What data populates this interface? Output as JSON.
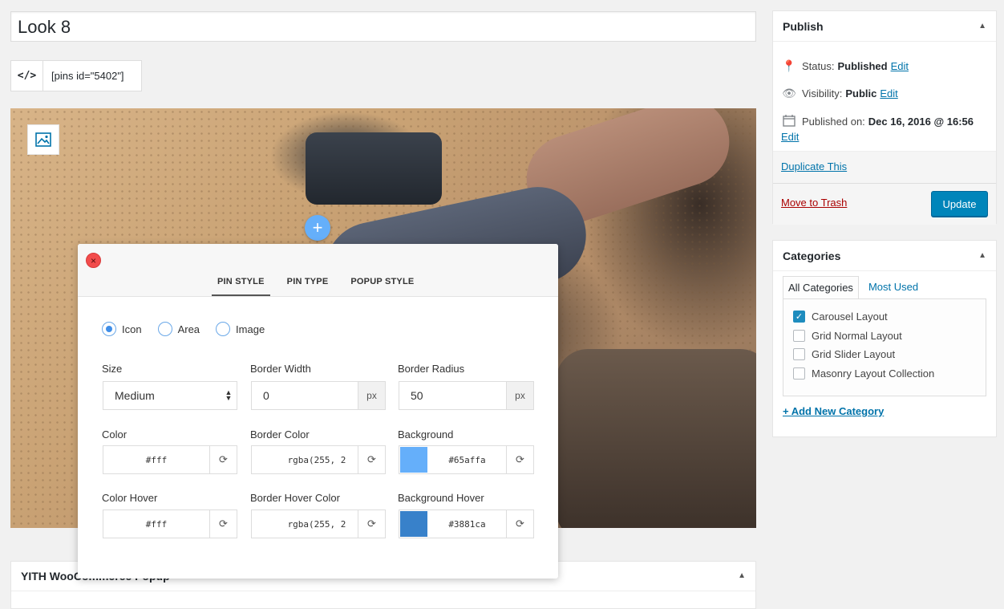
{
  "post": {
    "title": "Look 8",
    "shortcode_icon": "</>",
    "shortcode": "[pins id=\"5402\"]"
  },
  "image": {
    "image_button_icon": "image-icon",
    "pin_icon": "+"
  },
  "popup": {
    "close_icon": "×",
    "tabs": [
      "PIN STYLE",
      "PIN TYPE",
      "POPUP STYLE"
    ],
    "active_tab": "PIN STYLE",
    "pin_types": [
      {
        "label": "Icon",
        "checked": true
      },
      {
        "label": "Area",
        "checked": false
      },
      {
        "label": "Image",
        "checked": false
      }
    ],
    "size": {
      "label": "Size",
      "value": "Medium"
    },
    "border_width": {
      "label": "Border Width",
      "value": "0",
      "unit": "px"
    },
    "border_radius": {
      "label": "Border Radius",
      "value": "50",
      "unit": "px"
    },
    "color": {
      "label": "Color",
      "value": "#fff"
    },
    "border_color": {
      "label": "Border Color",
      "value": "rgba(255, 2"
    },
    "background": {
      "label": "Background",
      "value": "#65affa",
      "swatch": "#65affa"
    },
    "color_hover": {
      "label": "Color Hover",
      "value": "#fff"
    },
    "border_hover_color": {
      "label": "Border Hover Color",
      "value": "rgba(255, 2"
    },
    "background_hover": {
      "label": "Background Hover",
      "value": "#3881ca",
      "swatch": "#3881ca"
    }
  },
  "yith": {
    "title": "YITH WooCommerce Popup"
  },
  "publish": {
    "title": "Publish",
    "status_label": "Status:",
    "status_value": "Published",
    "visibility_label": "Visibility:",
    "visibility_value": "Public",
    "published_label": "Published on:",
    "published_value": "Dec 16, 2016 @ 16:56",
    "edit": "Edit",
    "duplicate": "Duplicate This",
    "trash": "Move to Trash",
    "update": "Update"
  },
  "categories": {
    "title": "Categories",
    "tab_all": "All Categories",
    "tab_most": "Most Used",
    "items": [
      {
        "label": "Carousel Layout",
        "checked": true
      },
      {
        "label": "Grid Normal Layout",
        "checked": false
      },
      {
        "label": "Grid Slider Layout",
        "checked": false
      },
      {
        "label": "Masonry Layout Collection",
        "checked": false
      }
    ],
    "add_new": "+ Add New Category"
  },
  "colors": {
    "accent": "#0085ba",
    "link": "#0073aa",
    "trash": "#a00000",
    "pin": "#65affa"
  }
}
